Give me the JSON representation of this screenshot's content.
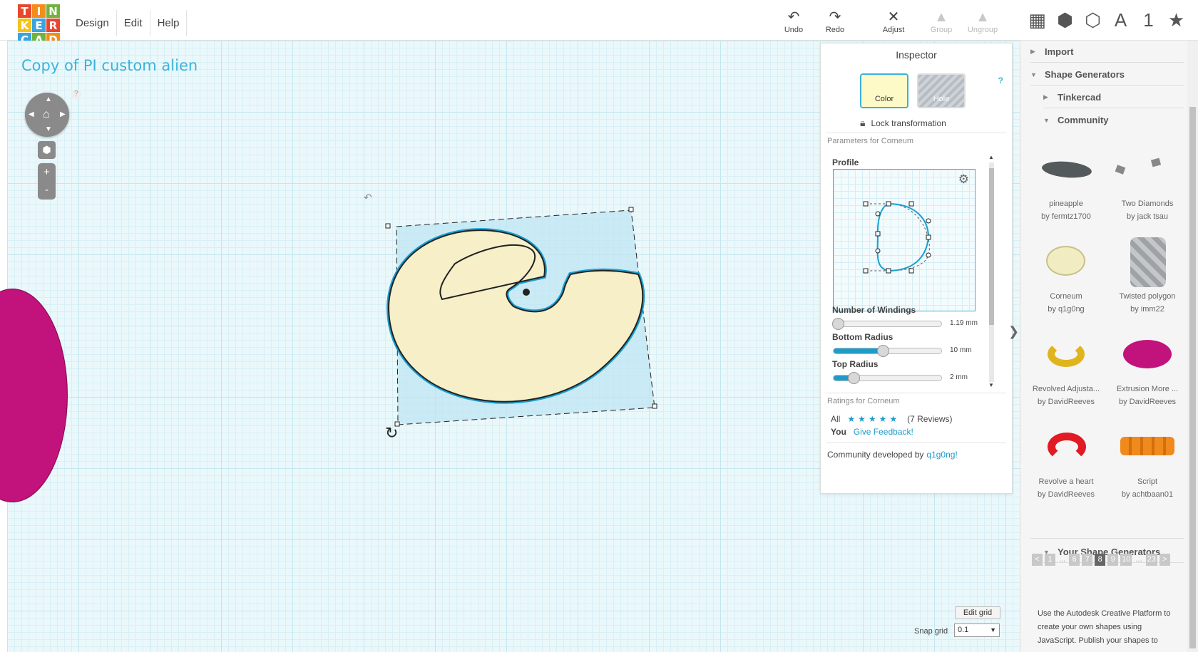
{
  "logo": {
    "letters": [
      "T",
      "I",
      "N",
      "K",
      "E",
      "R",
      "C",
      "A",
      "D"
    ],
    "colors": [
      "#e8472f",
      "#f48c1e",
      "#71b33f",
      "#f4c21e",
      "#3aa3e0",
      "#e8472f",
      "#3aa3e0",
      "#71b33f",
      "#f48c1e"
    ]
  },
  "menu": [
    "Design",
    "Edit",
    "Help"
  ],
  "toolbar": {
    "undo": {
      "label": "Undo",
      "icon": "undo-icon"
    },
    "redo": {
      "label": "Redo",
      "icon": "redo-icon"
    },
    "adjust": {
      "label": "Adjust",
      "icon": "adjust-icon"
    },
    "group": {
      "label": "Group",
      "icon": "group-icon"
    },
    "ungroup": {
      "label": "Ungroup",
      "icon": "ungroup-icon"
    }
  },
  "view_icons": [
    "grid-view-icon",
    "box-icon",
    "wireframe-box-icon",
    "text-shape-icon",
    "number-shape-icon",
    "star-icon"
  ],
  "view_glyphs": [
    "▦",
    "⬢",
    "⬡",
    "A",
    "1",
    "★"
  ],
  "design": {
    "title": "Copy of PI custom alien"
  },
  "nav": {
    "help": "?",
    "zoom_in": "+",
    "zoom_out": "-"
  },
  "inspector": {
    "title": "Inspector",
    "help": "?",
    "color_label": "Color",
    "hole_label": "Hole",
    "lock_label": "Lock transformation",
    "params_header": "Parameters for Corneum",
    "profile_label": "Profile",
    "params": [
      {
        "label": "Number of Windings",
        "value": "1.19 mm",
        "level": 0.0
      },
      {
        "label": "Bottom Radius",
        "value": "10 mm",
        "level": 0.45
      },
      {
        "label": "Top Radius",
        "value": "2 mm",
        "level": 0.18
      }
    ],
    "ratings_header": "Ratings for Corneum",
    "rating_all": "All",
    "rating_stars": "★★★★★",
    "rating_reviews": "(7 Reviews)",
    "rating_you": "You",
    "give_feedback": "Give Feedback!",
    "community_text": "Community developed by",
    "community_author": "q1g0ng!"
  },
  "sidebar": {
    "import": "Import",
    "shape_generators": "Shape Generators",
    "tinkercad": "Tinkercad",
    "community": "Community",
    "cards": [
      {
        "name": "pineapple",
        "by": "by fermtz1700"
      },
      {
        "name": "Two Diamonds",
        "by": "by jack tsau"
      },
      {
        "name": "Corneum",
        "by": "by q1g0ng"
      },
      {
        "name": "Twisted polygon",
        "by": "by imm22"
      },
      {
        "name": "Revolved Adjusta...",
        "by": "by DavidReeves"
      },
      {
        "name": "Extrusion More ...",
        "by": "by DavidReeves"
      },
      {
        "name": "Revolve a heart",
        "by": "by DavidReeves"
      },
      {
        "name": "Script",
        "by": "by achtbaan01"
      }
    ],
    "pager": [
      "<",
      "1",
      "...",
      "6",
      "7",
      "8",
      "9",
      "10",
      "...",
      "23",
      ">"
    ],
    "pager_current": "8",
    "your_generators": "Your Shape Generators",
    "your_text": "Use the Autodesk Creative Platform to create your own shapes using JavaScript. Publish your shapes to"
  },
  "grid": {
    "edit": "Edit grid",
    "snap_label": "Snap grid",
    "snap_value": "0.1"
  }
}
